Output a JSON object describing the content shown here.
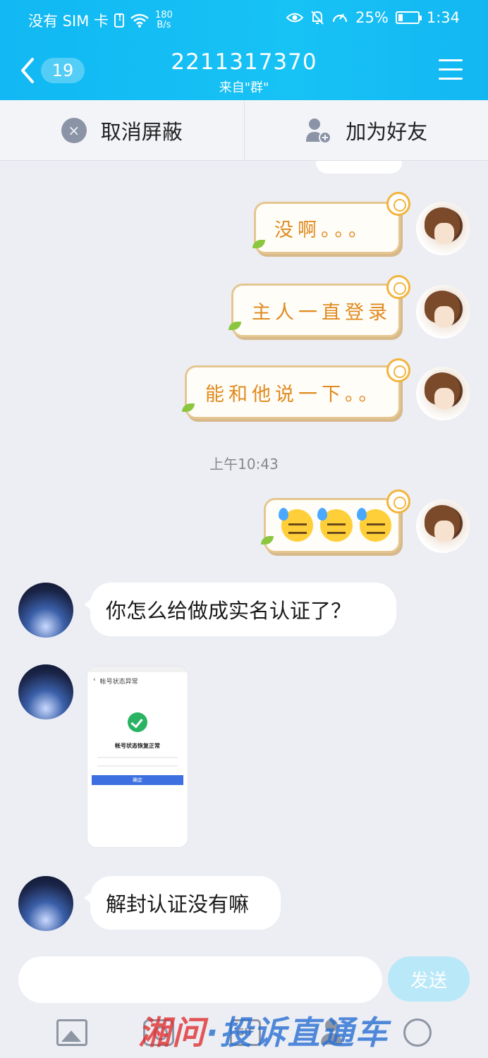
{
  "status_bar": {
    "carrier": "没有 SIM 卡",
    "net_speed_value": "180",
    "net_speed_unit": "B/s",
    "battery": "25%",
    "battery_level": 0.25,
    "time": "1:34"
  },
  "header": {
    "back_badge": "19",
    "title": "2211317370",
    "subtitle": "来自\"群\""
  },
  "actions": {
    "unblock": "取消屏蔽",
    "add_friend": "加为好友"
  },
  "messages": [
    {
      "from": "me",
      "style": "sun",
      "text": "没啊。。。"
    },
    {
      "from": "me",
      "style": "sun",
      "text": "主人一直登录"
    },
    {
      "from": "me",
      "style": "sun",
      "text": "能和他说一下。。"
    },
    {
      "type": "time",
      "text": "上午10:43"
    },
    {
      "from": "me",
      "style": "sun",
      "emoji": [
        "sweat-face",
        "sweat-face",
        "sweat-face"
      ]
    },
    {
      "from": "other",
      "text": "你怎么给做成实名认证了？"
    },
    {
      "from": "other",
      "type": "image",
      "image": {
        "header": "帐号状态异常",
        "title": "帐号状态恢复正常",
        "button": "确定"
      }
    },
    {
      "from": "other",
      "text": "解封认证没有嘛"
    }
  ],
  "input": {
    "value": "",
    "send_label": "发送"
  },
  "tools": [
    "image-icon",
    "camera-icon",
    "gif-icon",
    "contact-icon",
    "emoji-icon"
  ],
  "watermark": {
    "part1": "湘问",
    "part2": "·投诉直通车"
  },
  "colors": {
    "header_bg": "#17c2f5",
    "bubble_text": "#e08a1e",
    "send_btn": "#b9e8f8",
    "watermark_red": "#e02c2c",
    "watermark_blue": "#286ed2"
  }
}
